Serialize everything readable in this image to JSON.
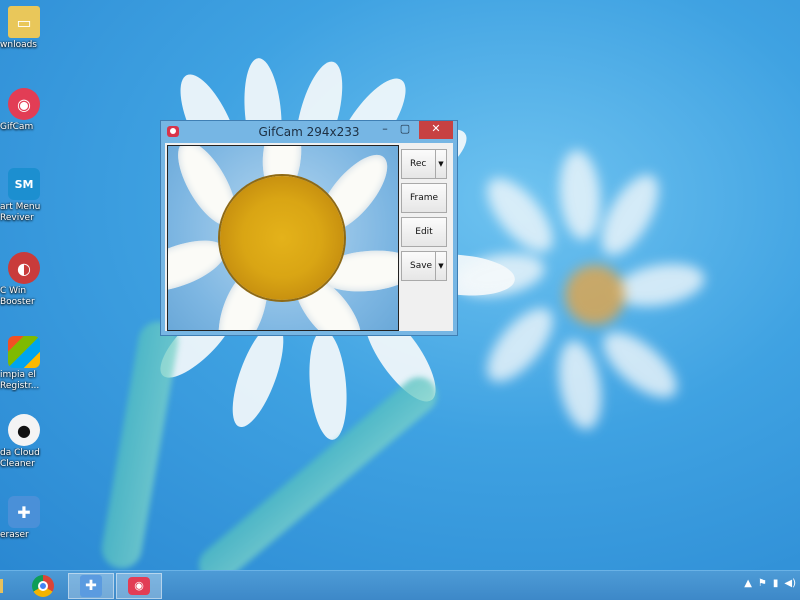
{
  "window": {
    "title": "GifCam 294x233",
    "controls": {
      "minimize": "–",
      "maximize": "▢",
      "close": "✕"
    },
    "buttons": {
      "rec": "Rec",
      "frame": "Frame",
      "edit": "Edit",
      "save": "Save"
    },
    "dropdown_arrow": "▼"
  },
  "desktop_icons": [
    {
      "label": "wnloads"
    },
    {
      "label": "GifCam"
    },
    {
      "label": "art Menu\nReviver"
    },
    {
      "label": "C Win\nBooster"
    },
    {
      "label": "impia el\nRegistr..."
    },
    {
      "label": "da Cloud\nCleaner"
    },
    {
      "label": "eraser"
    }
  ],
  "tray": {
    "up_arrow": "▲",
    "flag": "⚑",
    "battery": "▮",
    "volume": "◀)"
  }
}
